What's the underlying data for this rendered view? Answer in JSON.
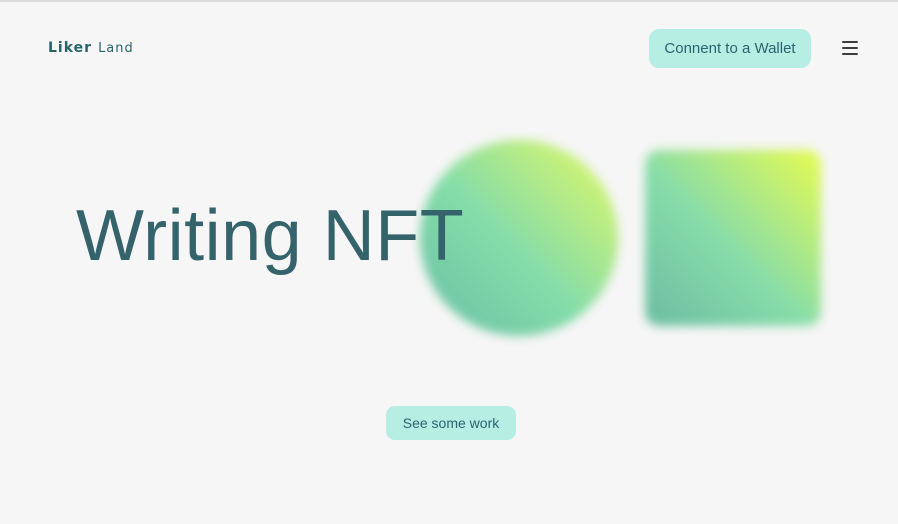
{
  "header": {
    "logo_primary": "Liker",
    "logo_secondary": "Land",
    "wallet_button_label": "Connent to a Wallet",
    "menu_icon": "hamburger-menu-icon"
  },
  "hero": {
    "title": "Writing NFT",
    "cta_label": "See some work"
  },
  "colors": {
    "background": "#f6f6f6",
    "accent": "#b6eee4",
    "text_primary": "#35636c",
    "gradient_yellow": "#e4fa64",
    "gradient_green": "#84dcaa"
  }
}
